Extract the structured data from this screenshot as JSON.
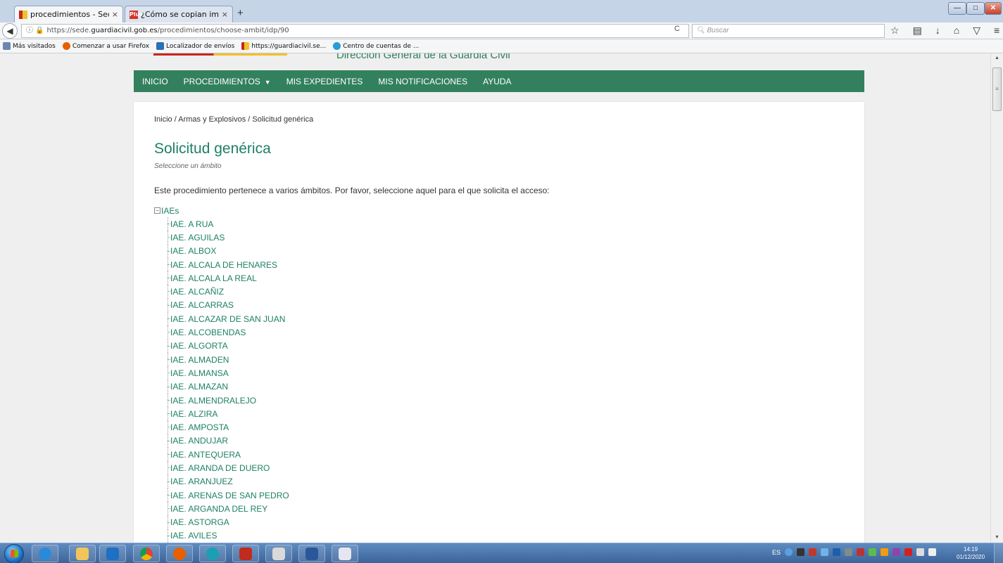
{
  "browser": {
    "tabs": [
      {
        "title": "procedimientos - Sede Electr",
        "close": "×"
      },
      {
        "title": "¿Cómo se copian imágenes d",
        "close": "×"
      }
    ],
    "new_tab": "+",
    "window_controls": {
      "minimize": "—",
      "maximize": "□",
      "close": "✕"
    },
    "url_prefix": "https://sede.",
    "url_domain": "guardiacivil.gob.es",
    "url_path": "/procedimientos/choose-ambit/idp/90",
    "search_placeholder": "Buscar",
    "bookmarks": [
      {
        "label": "Más visitados",
        "color": "#6c86b0"
      },
      {
        "label": "Comenzar a usar Firefox",
        "color": "#e66000"
      },
      {
        "label": "Localizador de envíos",
        "color": "#2b6fb6"
      },
      {
        "label": "https://guardiacivil.se...",
        "color": "#f2c029"
      },
      {
        "label": "Centro de cuentas de ...",
        "color": "#2a9bd6"
      }
    ]
  },
  "site": {
    "header_title": "Dirección General de la Guardia Civil",
    "menu": [
      {
        "label": "INICIO"
      },
      {
        "label": "PROCEDIMIENTOS",
        "caret": "▼"
      },
      {
        "label": "MIS EXPEDIENTES"
      },
      {
        "label": "MIS NOTIFICACIONES"
      },
      {
        "label": "AYUDA"
      }
    ],
    "breadcrumb": [
      "Inicio",
      "Armas y Explosivos",
      "Solicitud genérica"
    ],
    "breadcrumb_sep": " / ",
    "title": "Solicitud genérica",
    "subtitle": "Seleccione un ámbito",
    "intro": "Este procedimiento pertenece a varios ámbitos. Por favor, seleccione aquel para el que solicita el acceso:",
    "tree_root": "IAEs",
    "tree_items": [
      "IAE. A RUA",
      "IAE. AGUILAS",
      "IAE. ALBOX",
      "IAE. ALCALA DE HENARES",
      "IAE. ALCALA LA REAL",
      "IAE. ALCAÑIZ",
      "IAE. ALCARRAS",
      "IAE. ALCAZAR DE SAN JUAN",
      "IAE. ALCOBENDAS",
      "IAE. ALGORTA",
      "IAE. ALMADEN",
      "IAE. ALMANSA",
      "IAE. ALMAZAN",
      "IAE. ALMENDRALEJO",
      "IAE. ALZIRA",
      "IAE. AMPOSTA",
      "IAE. ANDUJAR",
      "IAE. ANTEQUERA",
      "IAE. ARANDA DE DUERO",
      "IAE. ARANJUEZ",
      "IAE. ARENAS DE SAN PEDRO",
      "IAE. ARGANDA DEL REY",
      "IAE. ASTORGA",
      "IAE. AVILES"
    ],
    "accent_color": "#33805e",
    "link_color": "#1e8066"
  },
  "taskbar": {
    "language": "ES",
    "time": "14:19",
    "date": "01/12/2020"
  }
}
